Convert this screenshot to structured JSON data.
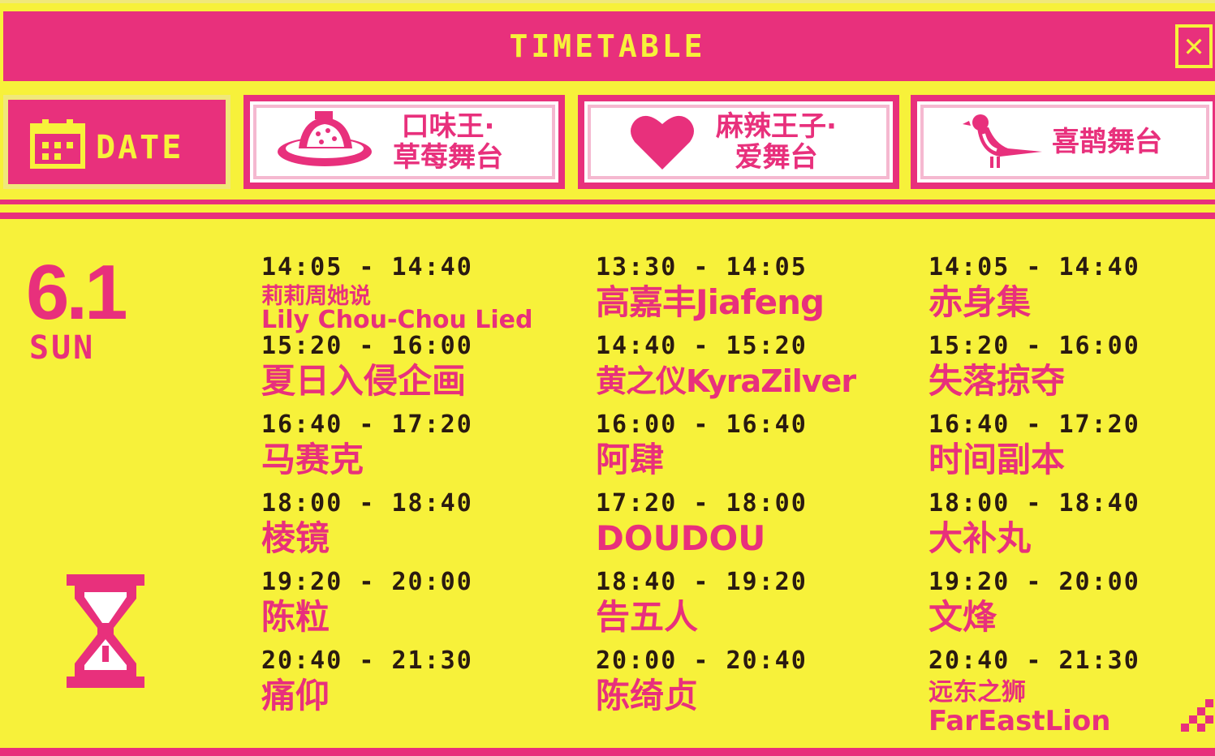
{
  "window": {
    "title": "TIMETABLE",
    "close_symbol": "✕"
  },
  "tabs": {
    "date_label": "DATE",
    "stages": [
      {
        "line1": "口味王·",
        "line2": "草莓舞台",
        "icon": "strawberry-hat-icon"
      },
      {
        "line1": "麻辣王子·",
        "line2": "爱舞台",
        "icon": "heart-icon"
      },
      {
        "line1": "喜鹊舞台",
        "line2": "",
        "icon": "magpie-icon"
      }
    ]
  },
  "day": {
    "date": "6.1",
    "weekday": "SUN"
  },
  "colors": {
    "pink": "#e8307c",
    "yellow": "#f7f13a",
    "text_dark": "#2a1a10"
  },
  "schedule": [
    {
      "stage": "草莓舞台",
      "slots": [
        {
          "time": "14:05 - 14:40",
          "artist": "莉莉周她说",
          "artist_line2": "Lily Chou-Chou Lied"
        },
        {
          "time": "15:20 - 16:00",
          "artist": "夏日入侵企画"
        },
        {
          "time": "16:40 - 17:20",
          "artist": "马赛克"
        },
        {
          "time": "18:00 - 18:40",
          "artist": "棱镜"
        },
        {
          "time": "19:20 - 20:00",
          "artist": "陈粒"
        },
        {
          "time": "20:40 - 21:30",
          "artist": "痛仰"
        }
      ]
    },
    {
      "stage": "爱舞台",
      "slots": [
        {
          "time": "13:30 - 14:05",
          "artist": "高嘉丰Jiafeng"
        },
        {
          "time": "14:40 - 15:20",
          "artist": "黄之仪KyraZilver"
        },
        {
          "time": "16:00 - 16:40",
          "artist": "阿肆"
        },
        {
          "time": "17:20 - 18:00",
          "artist": "DOUDOU"
        },
        {
          "time": "18:40 - 19:20",
          "artist": "告五人"
        },
        {
          "time": "20:00 - 20:40",
          "artist": "陈绮贞"
        }
      ]
    },
    {
      "stage": "喜鹊舞台",
      "slots": [
        {
          "time": "14:05 - 14:40",
          "artist": "赤身集"
        },
        {
          "time": "15:20 - 16:00",
          "artist": "失落掠夺"
        },
        {
          "time": "16:40 - 17:20",
          "artist": "时间副本"
        },
        {
          "time": "18:00 - 18:40",
          "artist": "大补丸"
        },
        {
          "time": "19:20 - 20:00",
          "artist": "文烽"
        },
        {
          "time": "20:40 - 21:30",
          "artist": "远东之狮",
          "artist_line2": "FarEastLion"
        }
      ]
    }
  ]
}
